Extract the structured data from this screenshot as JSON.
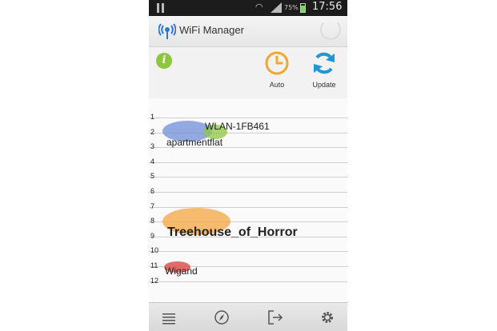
{
  "status_bar": {
    "battery_percent": "75%",
    "time": "17:56"
  },
  "action_bar": {
    "app_title": "WiFi Manager",
    "app_icon": "wifi-antenna-icon"
  },
  "toolbar": {
    "info_icon": "info-icon",
    "info_label": "i",
    "auto_label": "Auto",
    "update_label": "Update",
    "colors": {
      "info": "#8dc63f",
      "auto": "#f0a830",
      "update": "#1e96d8"
    }
  },
  "channels": [
    "1",
    "2",
    "3",
    "4",
    "5",
    "6",
    "7",
    "8",
    "9",
    "10",
    "11",
    "12"
  ],
  "networks": [
    {
      "name": "WLAN-1FB461",
      "channel": 2,
      "color": "#8dc63f"
    },
    {
      "name": "apartmentflat",
      "channel": 2,
      "color": "#6f8fd8"
    },
    {
      "name": "Treehouse_of_Horror",
      "channel": 8,
      "color": "#f5a640"
    },
    {
      "name": "Wigand",
      "channel": 11,
      "color": "#d9534f"
    }
  ],
  "bottom_nav": {
    "items": [
      "list-icon",
      "compass-icon",
      "exit-icon",
      "settings-icon"
    ]
  }
}
